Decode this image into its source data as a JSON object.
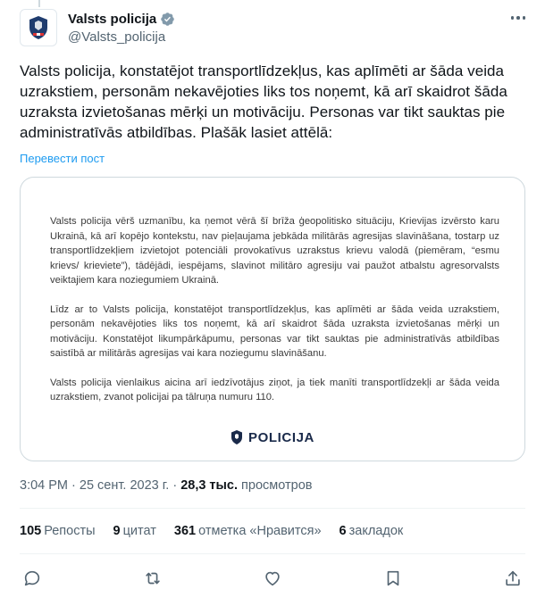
{
  "account": {
    "display_name": "Valsts policija",
    "handle": "@Valsts_policija",
    "verified_color": "#829aab"
  },
  "tweet": {
    "text": "Valsts policija, konstatējot transportlīdzekļus, kas aplīmēti ar šāda veida uzrakstiem, personām nekavējoties liks tos noņemt, kā arī skaidrot šāda uzraksta izvietošanas mērķi un motivāciju. Personas var tikt sauktas pie administratīvās atbildības. Plašāk lasiet attēlā:",
    "translate_label": "Перевести пост"
  },
  "media": {
    "paragraph1": "Valsts policija vērš uzmanību, ka ņemot vērā šī brīža ģeopolitisko situāciju, Krievijas izvērsto karu Ukrainā, kā arī kopējo kontekstu, nav pieļaujama jebkāda militārās agresijas slavināšana, tostarp uz transportlīdzekļiem izvietojot potenciāli provokatīvus uzrakstus krievu valodā (piemēram, “esmu krievs/ krieviete”), tādējādi, iespējams, slavinot militāro agresiju vai paužot atbalstu agresorvalsts veiktajiem kara noziegumiem Ukrainā.",
    "paragraph2": "Līdz ar to Valsts policija, konstatējot transportlīdzekļus, kas aplīmēti ar šāda veida uzrakstiem, personām nekavējoties liks tos noņemt, kā arī skaidrot šāda uzraksta izvietošanas mērķi un motivāciju. Konstatējot likumpārkāpumu, personas var tikt sauktas pie administratīvās atbildības saistībā ar militārās agresijas vai kara noziegumu slavināšanu.",
    "paragraph3": "Valsts policija vienlaikus aicina arī iedzīvotājus ziņot, ja tiek manīti transportlīdzekļi ar šāda veida uzrakstiem, zvanot policijai pa tālruņa numuru 110.",
    "logo_text": "POLICIJA"
  },
  "meta": {
    "time": "3:04 PM",
    "separator1": " · ",
    "date": "25 сент. 2023 г.",
    "separator2": " · ",
    "views_count": "28,3 тыс.",
    "views_label": "просмотров"
  },
  "stats": {
    "reposts_count": "105",
    "reposts_label": "Репосты",
    "quotes_count": "9",
    "quotes_label": "цитат",
    "likes_count": "361",
    "likes_label": "отметка «Нравится»",
    "bookmarks_count": "6",
    "bookmarks_label": "закладок"
  },
  "icons": {
    "reply": "reply-icon",
    "repost": "repost-icon",
    "like": "heart-icon",
    "bookmark": "bookmark-icon",
    "share": "share-icon",
    "more": "more-icon",
    "verified": "verified-badge-icon"
  },
  "colors": {
    "link": "#1d9bf0",
    "secondary_text": "#536471",
    "border": "#cfd9de",
    "logo_navy": "#1a2a4a"
  }
}
